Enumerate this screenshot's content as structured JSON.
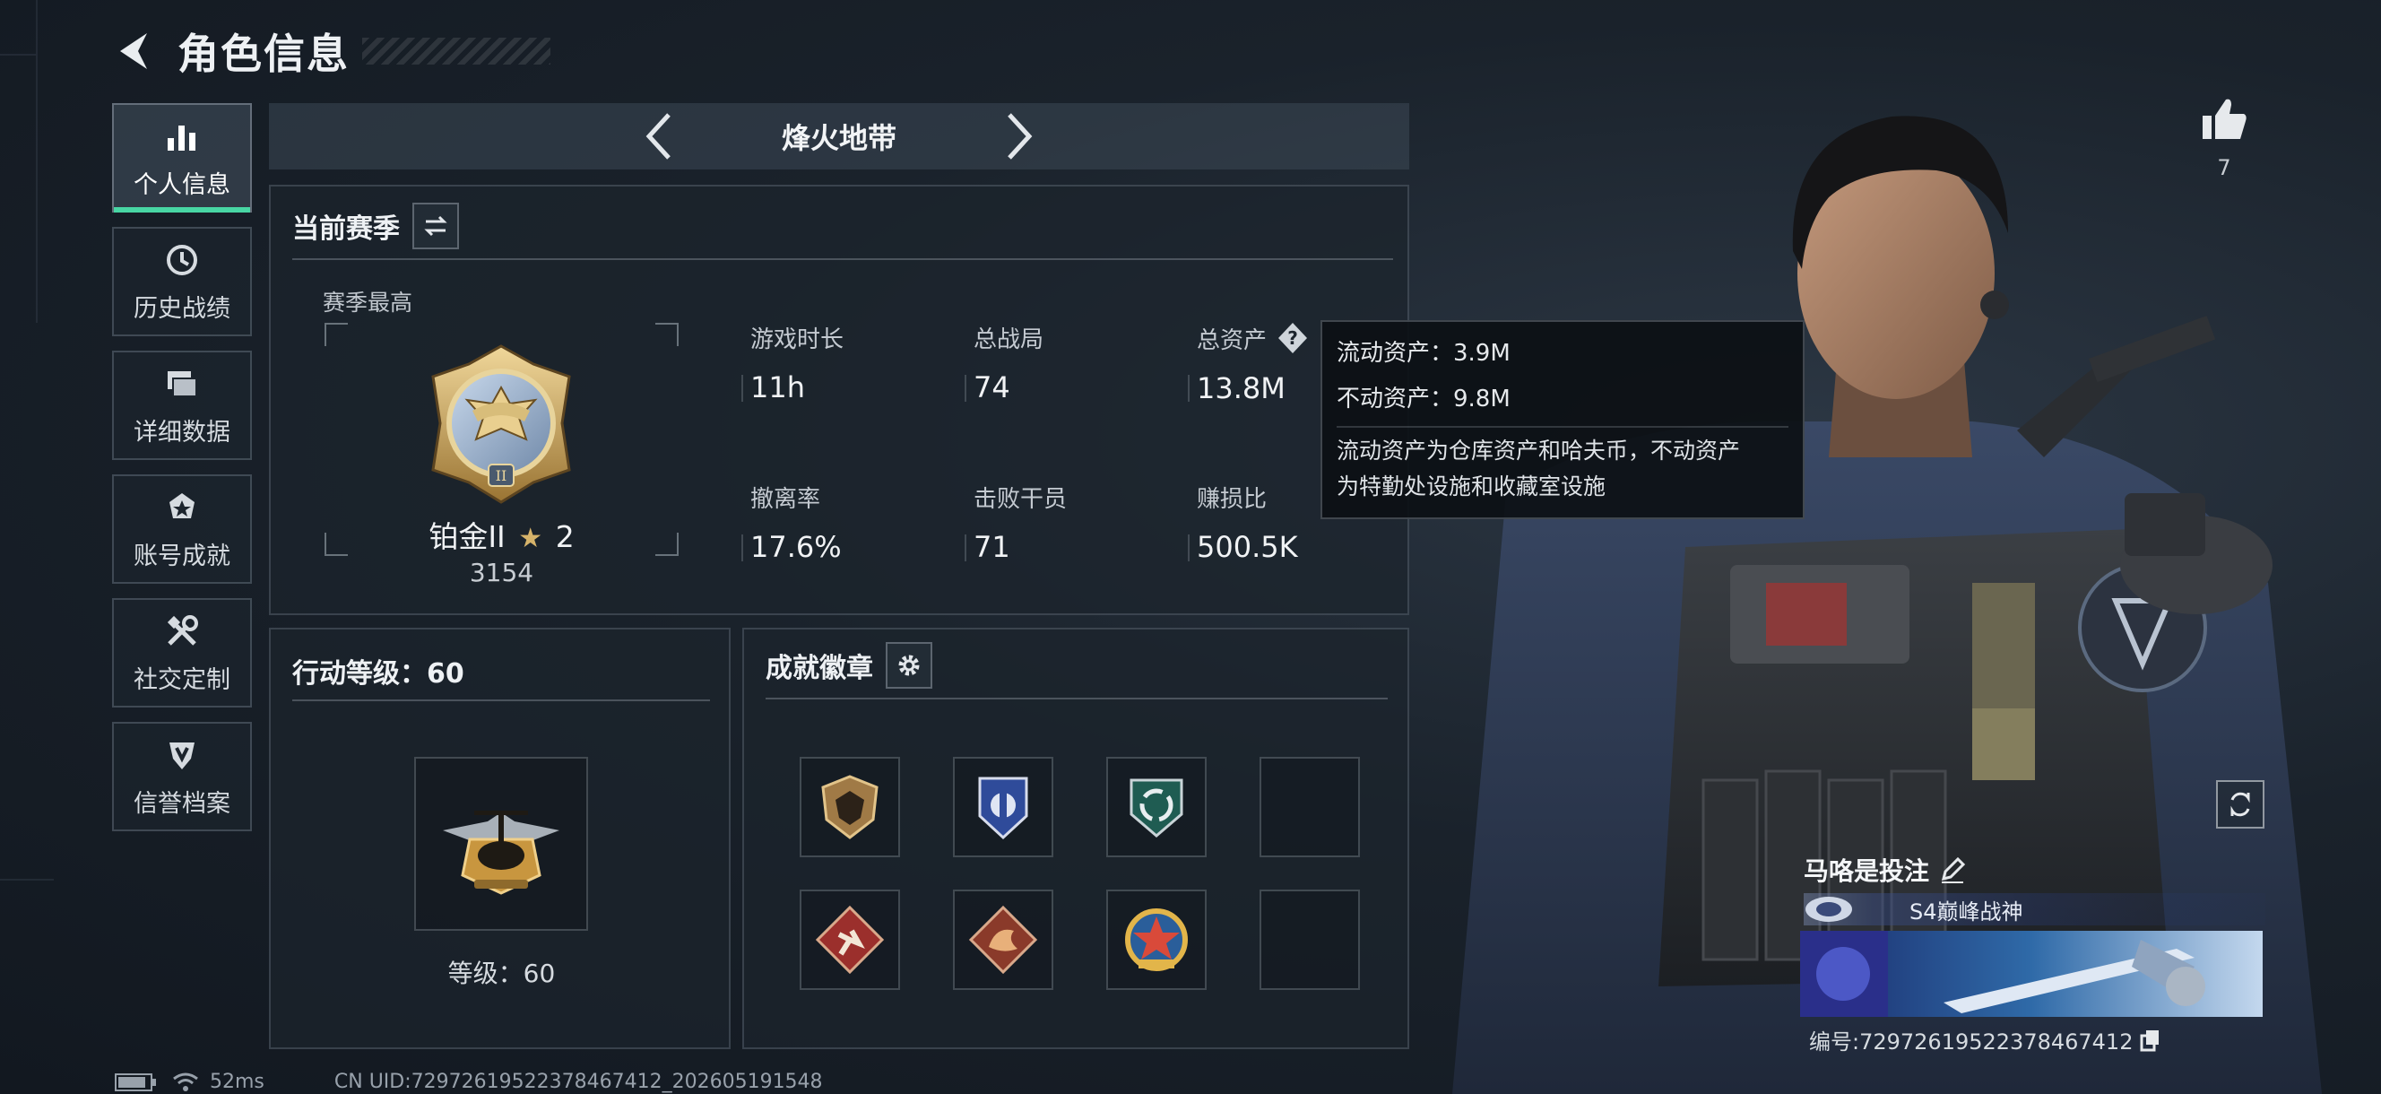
{
  "header": {
    "title": "角色信息"
  },
  "nav": {
    "items": [
      {
        "label": "个人信息",
        "icon": "bar-chart-icon",
        "active": true
      },
      {
        "label": "历史战绩",
        "icon": "history-clock-icon",
        "active": false
      },
      {
        "label": "详细数据",
        "icon": "folder-stack-icon",
        "active": false
      },
      {
        "label": "账号成就",
        "icon": "medal-icon",
        "active": false
      },
      {
        "label": "社交定制",
        "icon": "tools-icon",
        "active": false
      },
      {
        "label": "信誉档案",
        "icon": "shield-emblem-icon",
        "active": false
      }
    ]
  },
  "mode": {
    "title": "烽火地带"
  },
  "season": {
    "title": "当前赛季",
    "best_label": "赛季最高",
    "rank_name": "铂金II",
    "rank_star": "★",
    "rank_stars": "2",
    "rank_points": "3154",
    "stats": [
      {
        "label": "游戏时长",
        "value": "11h"
      },
      {
        "label": "总战局",
        "value": "74"
      },
      {
        "label": "总资产",
        "value": "13.8M",
        "has_help": true
      },
      {
        "label": "撤离率",
        "value": "17.6%"
      },
      {
        "label": "击败干员",
        "value": "71"
      },
      {
        "label": "赚损比",
        "value": "500.5K"
      }
    ]
  },
  "tooltip": {
    "liquid": "流动资产：3.9M",
    "fixed": "不动资产：9.8M",
    "desc_line1": "流动资产为仓库资产和哈夫币，不动资产",
    "desc_line2": "为特勤处设施和收藏室设施"
  },
  "action_level": {
    "title": "行动等级：60",
    "level_text": "等级：60"
  },
  "badges": {
    "title": "成就徽章",
    "slots": [
      {
        "icon": "hex-shield-badge-icon",
        "filled": true
      },
      {
        "icon": "blue-crest-badge-icon",
        "filled": true
      },
      {
        "icon": "green-recycle-badge-icon",
        "filled": true
      },
      {
        "icon": "",
        "filled": false
      },
      {
        "icon": "runner-diamond-badge-icon",
        "filled": true
      },
      {
        "icon": "dragon-diamond-badge-icon",
        "filled": true
      },
      {
        "icon": "star-roundel-badge-icon",
        "filled": true
      },
      {
        "icon": "",
        "filled": false
      }
    ]
  },
  "profile": {
    "likes": "7",
    "name": "马咯是投注",
    "title": "S4巅峰战神",
    "uid_label": "编号:7297261952237846741​2",
    "uid": "编号:72972619522378467412"
  },
  "status_bar": {
    "ping": "52ms",
    "cn_uid": "CN UID:72972619522378467412_202605191548"
  },
  "colors": {
    "accent_green": "#48d6a4",
    "gold": "#d6b36a",
    "background": "#1a222b"
  }
}
